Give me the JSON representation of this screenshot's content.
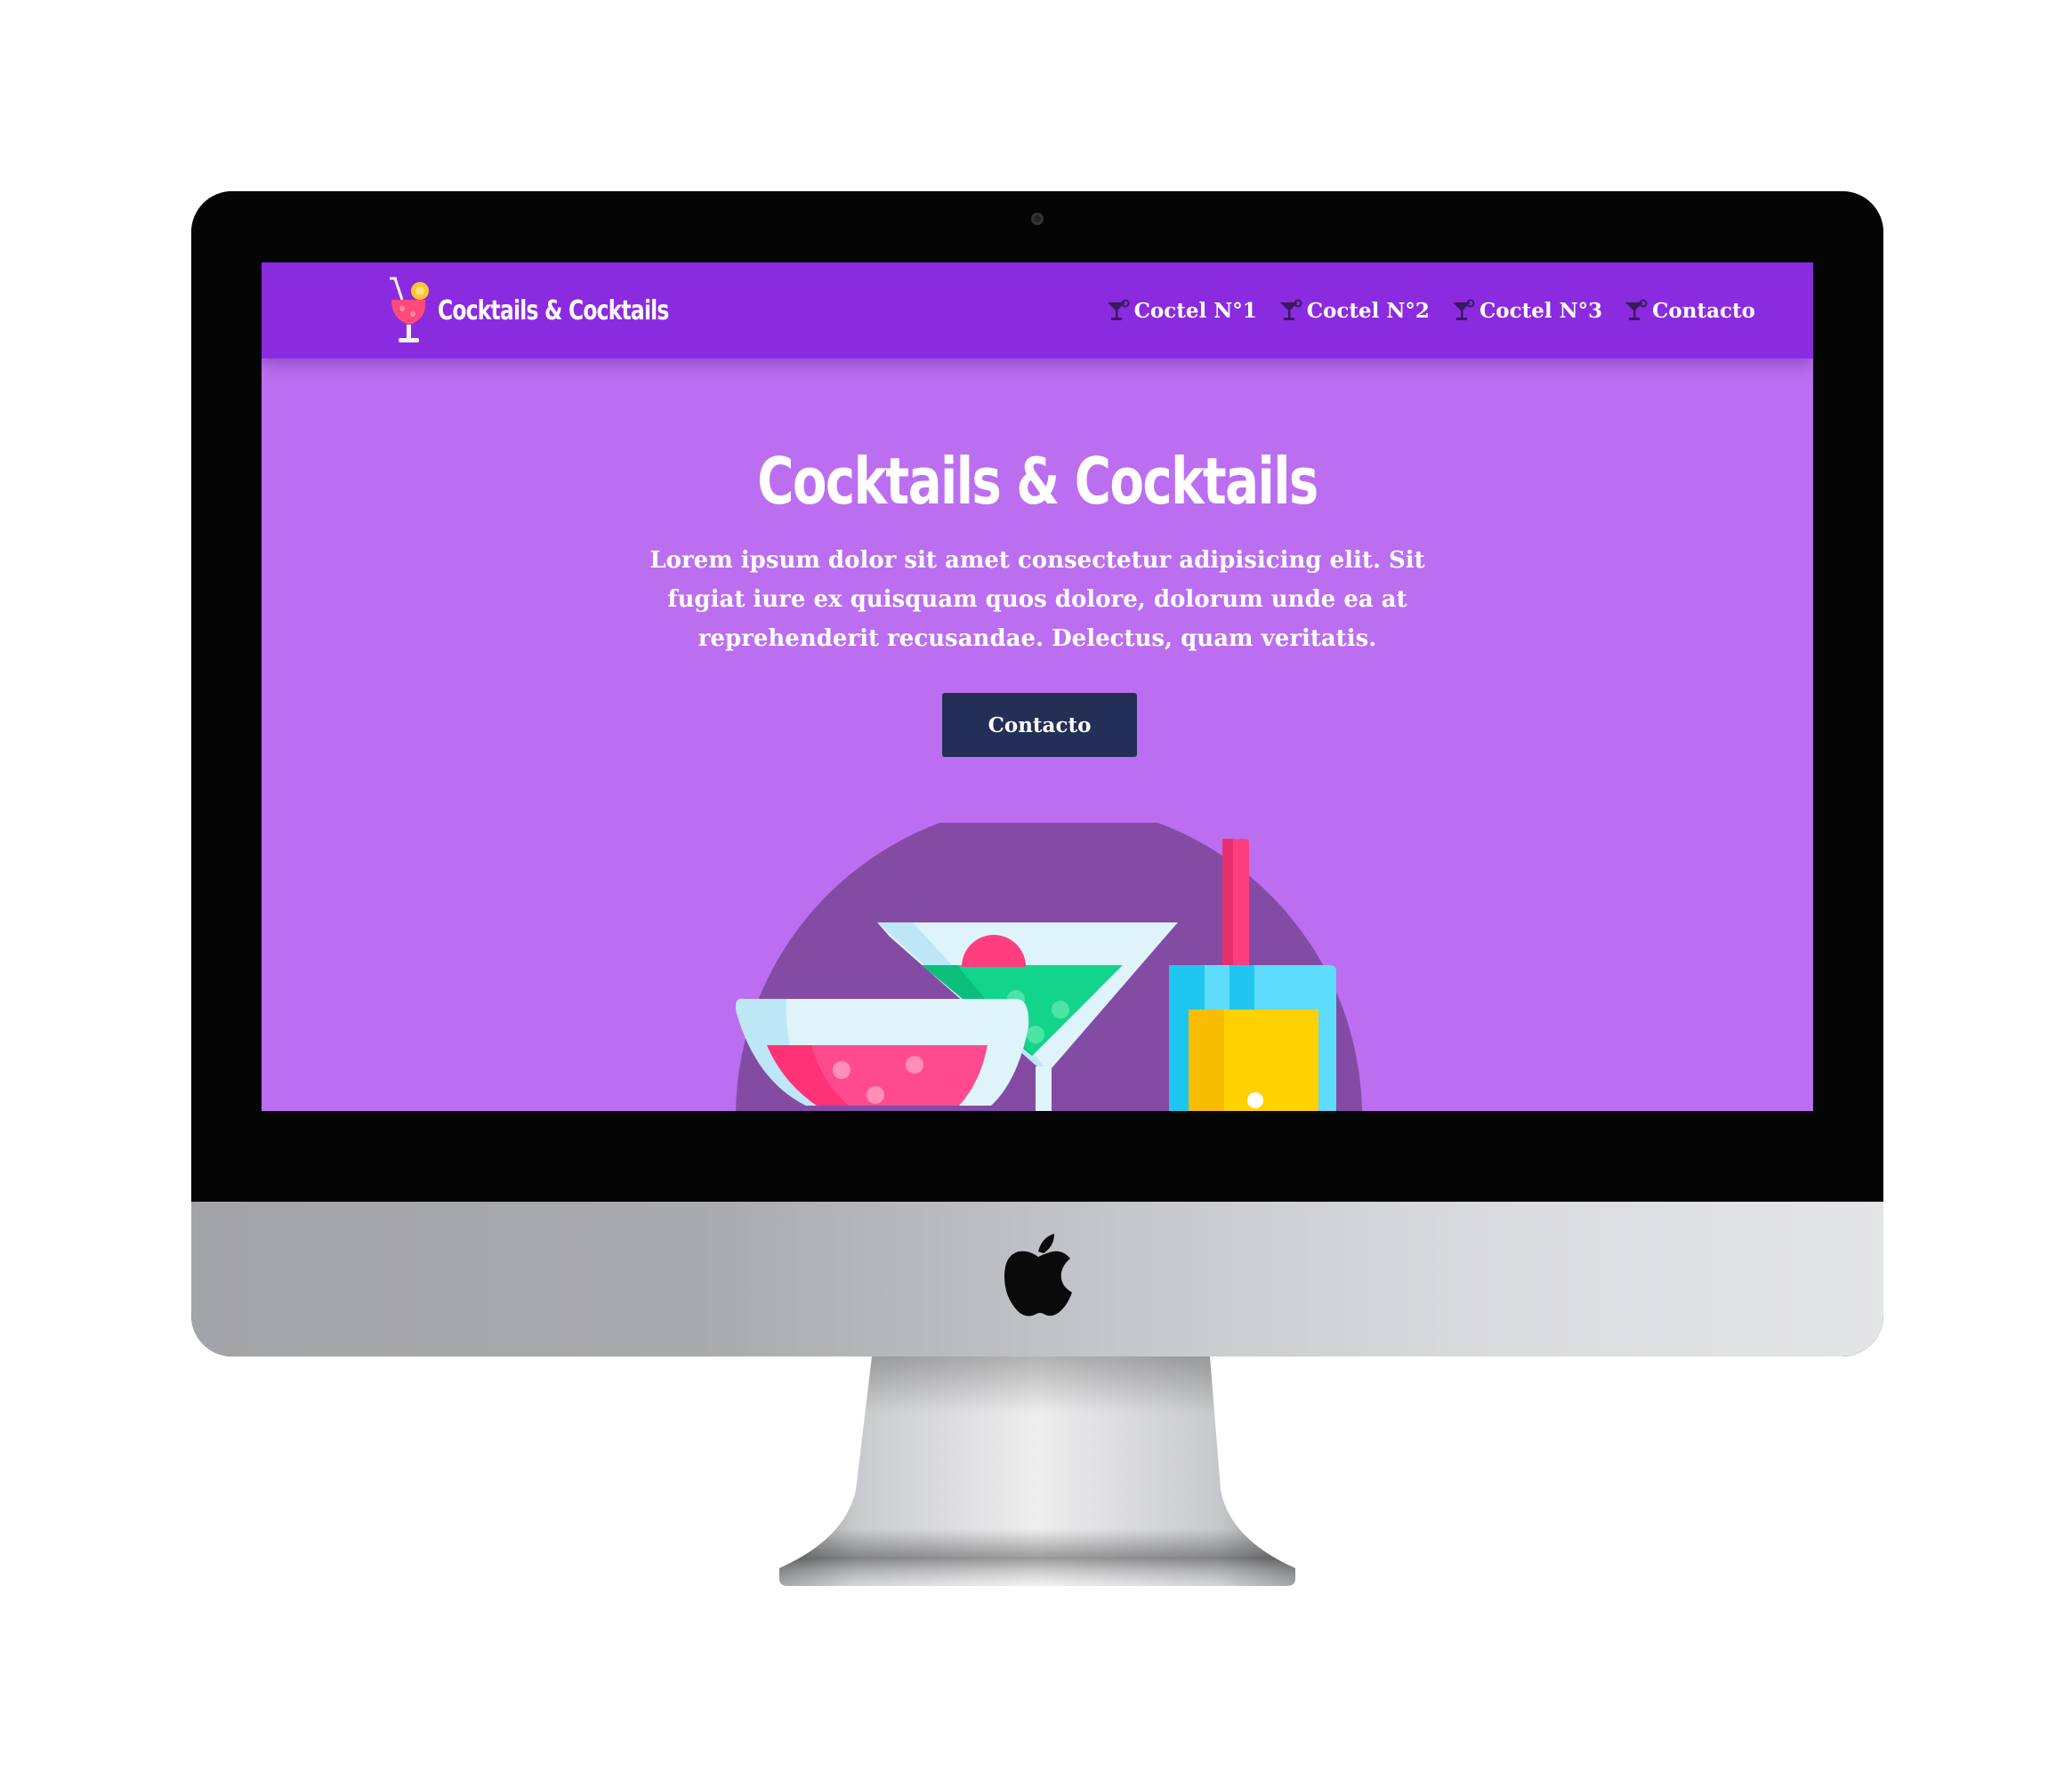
{
  "site": {
    "brand_name": "Cocktails & Cocktails",
    "nav": [
      {
        "label": "Coctel N°1",
        "icon": "cocktail-glass-icon"
      },
      {
        "label": "Coctel N°2",
        "icon": "cocktail-glass-icon"
      },
      {
        "label": "Coctel N°3",
        "icon": "cocktail-glass-icon"
      },
      {
        "label": "Contacto",
        "icon": "cocktail-glass-icon"
      }
    ]
  },
  "hero": {
    "title": "Cocktails & Cocktails",
    "description": "Lorem ipsum dolor sit amet consectetur adipisicing elit. Sit fugiat iure ex quisquam quos dolore, dolorum unde ea at reprehenderit recusandae. Delectus, quam veritatis.",
    "cta_label": "Contacto"
  },
  "colors": {
    "navbar": "#8a2be0",
    "hero_background": "#bb6ff0",
    "button": "#232f56",
    "text": "#ffffff"
  }
}
